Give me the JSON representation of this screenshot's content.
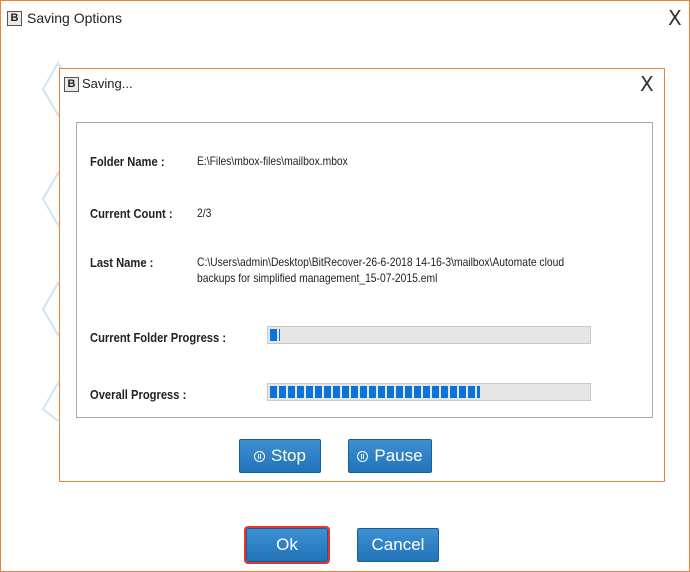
{
  "outer_window": {
    "title": "Saving Options",
    "logo_letter": "B",
    "close_glyph": "X",
    "ok_label": "Ok",
    "cancel_label": "Cancel"
  },
  "saving_dialog": {
    "title": "Saving...",
    "logo_letter": "B",
    "close_glyph": "X",
    "fields": {
      "folder_name": {
        "label": "Folder Name :",
        "value": "E:\\Files\\mbox-files\\mailbox.mbox"
      },
      "current_count": {
        "label": "Current Count :",
        "value": "2/3"
      },
      "last_name": {
        "label": "Last Name :",
        "value_line1": "C:\\Users\\admin\\Desktop\\BitRecover-26-6-2018 14-16-3\\mailbox\\Automate cloud",
        "value_line2": "backups for simplified management_15-07-2015.eml"
      }
    },
    "current_folder_progress": {
      "label": "Current Folder Progress :",
      "fraction": 0.03
    },
    "overall_progress": {
      "label": "Overall Progress :",
      "fraction": 0.66
    },
    "stop_label": "Stop",
    "pause_label": "Pause"
  },
  "colors": {
    "window_border": "#e8833a",
    "button_blue": "#2f83c9",
    "progress_blue": "#0a74d8",
    "ok_focus_outline": "#e8332b"
  },
  "icons": {
    "stop_button_icon": "pause-circle-icon",
    "pause_button_icon": "pause-circle-icon",
    "background_decor": "diamond-outline-icon"
  }
}
